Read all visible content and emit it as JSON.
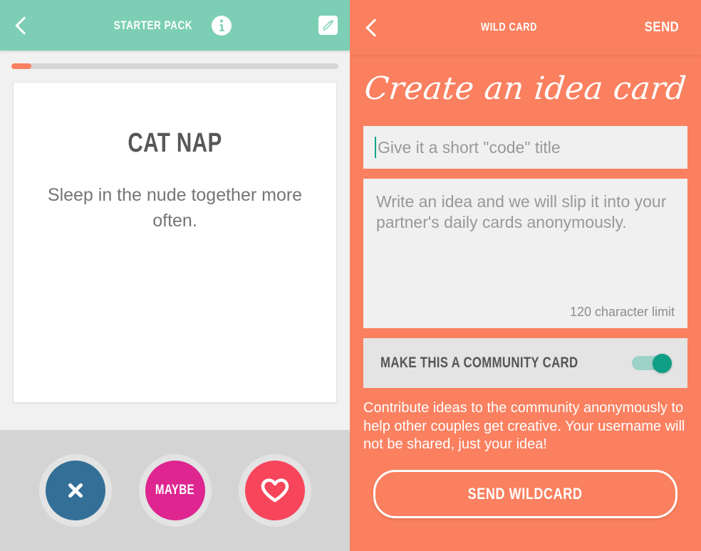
{
  "colors": {
    "teal_header": "#7ccfb4",
    "orange": "#fa8060",
    "progress_fill": "#fa8060",
    "nope_blue": "#336f96",
    "maybe_magenta": "#de2590",
    "like_red": "#f7455b",
    "toggle_on": "#0f9e86",
    "caret_teal": "#12a58a",
    "card_title_gray": "#575757",
    "placeholder_gray": "#989898"
  },
  "left_panel": {
    "header": {
      "back_icon": "chevron-left-icon",
      "title": "STARTER PACK",
      "info_icon": "info-icon",
      "edit_icon": "pencil-edit-icon"
    },
    "progress": {
      "percent": 6,
      "label": ""
    },
    "card": {
      "title": "CAT NAP",
      "body": "Sleep in the nude together more often."
    },
    "actions": [
      {
        "name": "nope",
        "icon": "close-x-icon",
        "label": "",
        "color": "#336f96"
      },
      {
        "name": "maybe",
        "icon": "",
        "label": "MAYBE",
        "color": "#de2590"
      },
      {
        "name": "like",
        "icon": "heart-outline-icon",
        "label": "",
        "color": "#f7455b"
      }
    ]
  },
  "right_panel": {
    "header": {
      "back_icon": "chevron-left-icon",
      "title": "WILD CARD",
      "send_label": "SEND"
    },
    "heading": "Create an idea card",
    "title_field": {
      "value": "",
      "placeholder": "Give it a short \"code\" title"
    },
    "idea_field": {
      "value": "",
      "placeholder": "Write an idea and we will slip it into your partner's daily cards anonymously.",
      "char_limit_note": "120 character limit"
    },
    "community_toggle": {
      "label": "MAKE THIS A COMMUNITY CARD",
      "state": "on"
    },
    "contribution_note": "Contribute ideas to the community anonymously to help other couples get creative. Your username will not be shared, just your idea!",
    "submit_button": "SEND WILDCARD"
  }
}
